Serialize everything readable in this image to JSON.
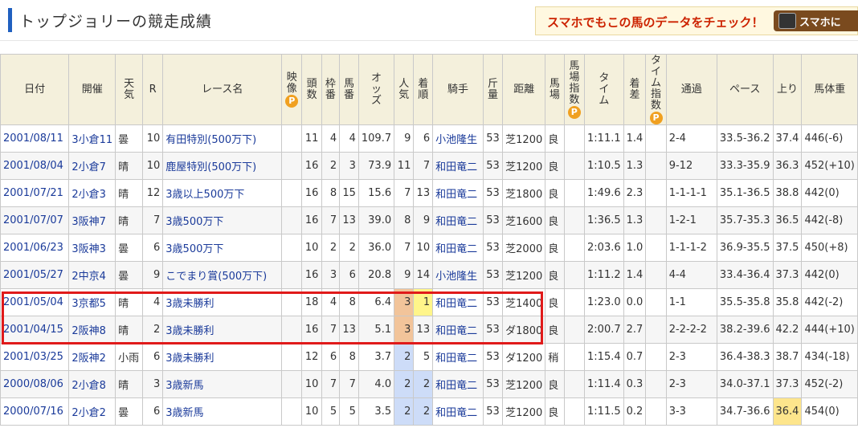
{
  "header": {
    "title": "トップジョリーの競走成績",
    "promo_text": "スマホでもこの馬のデータをチェック！",
    "promo_button": "スマホに"
  },
  "table": {
    "columns": [
      "日付",
      "開催",
      "天気",
      "R",
      "レース名",
      "映像",
      "頭数",
      "枠番",
      "馬番",
      "オッズ",
      "人気",
      "着順",
      "騎手",
      "斤量",
      "距離",
      "馬場",
      "馬場指数",
      "タイム",
      "着差",
      "タイム指数",
      "通過",
      "ペース",
      "上り",
      "馬体重"
    ],
    "badge_label": "P",
    "rows": [
      {
        "date": "2001/08/11",
        "kaisai": "3小倉11",
        "weather": "曇",
        "r": "10",
        "race": "有田特別(500万下)",
        "heads": "11",
        "waku": "4",
        "uma": "4",
        "odds": "109.7",
        "ninki": "9",
        "chaku": "6",
        "jockey": "小池隆生",
        "kinryo": "53",
        "dist": "芝1200",
        "baba": "良",
        "time": "1:11.1",
        "sa": "1.4",
        "tsuka": "2-4",
        "pace": "33.5-36.2",
        "agari": "37.4",
        "weight": "446(-6)"
      },
      {
        "date": "2001/08/04",
        "kaisai": "2小倉7",
        "weather": "晴",
        "r": "10",
        "race": "鹿屋特別(500万下)",
        "heads": "16",
        "waku": "2",
        "uma": "3",
        "odds": "73.9",
        "ninki": "11",
        "chaku": "7",
        "jockey": "和田竜二",
        "kinryo": "53",
        "dist": "芝1200",
        "baba": "良",
        "time": "1:10.5",
        "sa": "1.3",
        "tsuka": "9-12",
        "pace": "33.3-35.9",
        "agari": "36.3",
        "weight": "452(+10)"
      },
      {
        "date": "2001/07/21",
        "kaisai": "2小倉3",
        "weather": "晴",
        "r": "12",
        "race": "3歳以上500万下",
        "heads": "16",
        "waku": "8",
        "uma": "15",
        "odds": "15.6",
        "ninki": "7",
        "chaku": "13",
        "jockey": "和田竜二",
        "kinryo": "53",
        "dist": "芝1800",
        "baba": "良",
        "time": "1:49.6",
        "sa": "2.3",
        "tsuka": "1-1-1-1",
        "pace": "35.1-36.5",
        "agari": "38.8",
        "weight": "442(0)"
      },
      {
        "date": "2001/07/07",
        "kaisai": "3阪神7",
        "weather": "晴",
        "r": "7",
        "race": "3歳500万下",
        "heads": "16",
        "waku": "7",
        "uma": "13",
        "odds": "39.0",
        "ninki": "8",
        "chaku": "9",
        "jockey": "和田竜二",
        "kinryo": "53",
        "dist": "芝1600",
        "baba": "良",
        "time": "1:36.5",
        "sa": "1.3",
        "tsuka": "1-2-1",
        "pace": "35.7-35.3",
        "agari": "36.5",
        "weight": "442(-8)"
      },
      {
        "date": "2001/06/23",
        "kaisai": "3阪神3",
        "weather": "曇",
        "r": "6",
        "race": "3歳500万下",
        "heads": "10",
        "waku": "2",
        "uma": "2",
        "odds": "36.0",
        "ninki": "7",
        "chaku": "10",
        "jockey": "和田竜二",
        "kinryo": "53",
        "dist": "芝2000",
        "baba": "良",
        "time": "2:03.6",
        "sa": "1.0",
        "tsuka": "1-1-1-2",
        "pace": "36.9-35.5",
        "agari": "37.5",
        "weight": "450(+8)"
      },
      {
        "date": "2001/05/27",
        "kaisai": "2中京4",
        "weather": "曇",
        "r": "9",
        "race": "こでまり賞(500万下)",
        "heads": "16",
        "waku": "3",
        "uma": "6",
        "odds": "20.8",
        "ninki": "9",
        "chaku": "14",
        "jockey": "小池隆生",
        "kinryo": "53",
        "dist": "芝1200",
        "baba": "良",
        "time": "1:11.2",
        "sa": "1.4",
        "tsuka": "4-4",
        "pace": "33.4-36.4",
        "agari": "37.3",
        "weight": "442(0)"
      },
      {
        "date": "2001/05/04",
        "kaisai": "3京都5",
        "weather": "晴",
        "r": "4",
        "race": "3歳未勝利",
        "heads": "18",
        "waku": "4",
        "uma": "8",
        "odds": "6.4",
        "ninki": "3",
        "chaku": "1",
        "jockey": "和田竜二",
        "kinryo": "53",
        "dist": "芝1400",
        "baba": "良",
        "time": "1:23.0",
        "sa": "0.0",
        "tsuka": "1-1",
        "pace": "35.5-35.8",
        "agari": "35.8",
        "weight": "442(-2)"
      },
      {
        "date": "2001/04/15",
        "kaisai": "2阪神8",
        "weather": "晴",
        "r": "2",
        "race": "3歳未勝利",
        "heads": "16",
        "waku": "7",
        "uma": "13",
        "odds": "5.1",
        "ninki": "3",
        "chaku": "13",
        "jockey": "和田竜二",
        "kinryo": "53",
        "dist": "ダ1800",
        "baba": "良",
        "time": "2:00.7",
        "sa": "2.7",
        "tsuka": "2-2-2-2",
        "pace": "38.2-39.6",
        "agari": "42.2",
        "weight": "444(+10)"
      },
      {
        "date": "2001/03/25",
        "kaisai": "2阪神2",
        "weather": "小雨",
        "r": "6",
        "race": "3歳未勝利",
        "heads": "12",
        "waku": "6",
        "uma": "8",
        "odds": "3.7",
        "ninki": "2",
        "chaku": "5",
        "jockey": "和田竜二",
        "kinryo": "53",
        "dist": "ダ1200",
        "baba": "稍",
        "time": "1:15.4",
        "sa": "0.7",
        "tsuka": "2-3",
        "pace": "36.4-38.3",
        "agari": "38.7",
        "weight": "434(-18)"
      },
      {
        "date": "2000/08/06",
        "kaisai": "2小倉8",
        "weather": "晴",
        "r": "3",
        "race": "3歳新馬",
        "heads": "10",
        "waku": "7",
        "uma": "7",
        "odds": "4.0",
        "ninki": "2",
        "chaku": "2",
        "jockey": "和田竜二",
        "kinryo": "53",
        "dist": "芝1200",
        "baba": "良",
        "time": "1:11.4",
        "sa": "0.3",
        "tsuka": "2-3",
        "pace": "34.0-37.1",
        "agari": "37.3",
        "weight": "452(-2)"
      },
      {
        "date": "2000/07/16",
        "kaisai": "2小倉2",
        "weather": "曇",
        "r": "6",
        "race": "3歳新馬",
        "heads": "10",
        "waku": "5",
        "uma": "5",
        "odds": "3.5",
        "ninki": "2",
        "chaku": "2",
        "jockey": "和田竜二",
        "kinryo": "53",
        "dist": "芝1200",
        "baba": "良",
        "time": "1:11.5",
        "sa": "0.2",
        "tsuka": "3-3",
        "pace": "34.7-36.6",
        "agari": "36.4",
        "weight": "454(0)"
      }
    ]
  },
  "colors": {
    "header_bg": "#f4f0dc",
    "link": "#1a3a9a",
    "highlight_box": "#e01a1a",
    "ninki_3": "#f2c49a",
    "ninki_2": "#cddcf8",
    "chaku_1": "#fff58a",
    "agari_best": "#fde58c",
    "badge": "#f0a020"
  }
}
